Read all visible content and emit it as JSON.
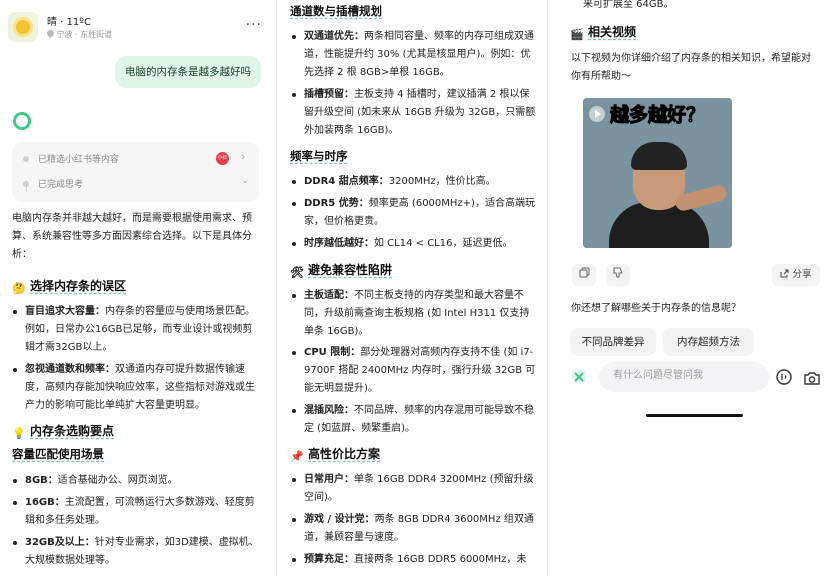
{
  "left": {
    "weather": "晴 · 11ºC",
    "location": "宁波 · 东胜街道",
    "more": "···",
    "user_message": "电脑的内存条是越多越好吗",
    "status_rows": [
      "已精选小红书等内容",
      "已完成思考"
    ],
    "intro": "电脑内存条并非越大越好，而是需要根据使用需求、预算、系统兼容性等多方面因素综合选择。以下是具体分析：",
    "section1": "选择内存条的误区",
    "bullets1": [
      {
        "bold": "盲目追求大容量：",
        "text": "内存条的容量应与使用场景匹配。例如，日常办公16GB已足够，而专业设计或视频剪辑才需32GB以上。"
      },
      {
        "bold": "忽视通道数和频率：",
        "text": "双通道内存可提升数据传输速度，高频内存能加快响应效率，这些指标对游戏或生产力的影响可能比单纯扩大容量更明显。"
      }
    ],
    "section2": "内存条选购要点",
    "sub1": "容量匹配使用场景",
    "bullets2": [
      {
        "bold": "8GB：",
        "text": "适合基础办公、网页浏览。"
      },
      {
        "bold": "16GB：",
        "text": "主流配置，可流畅运行大多数游戏、轻度剪辑和多任务处理。"
      },
      {
        "bold": "32GB及以上：",
        "text": "针对专业需求，如3D建模、虚拟机、大规模数据处理等。"
      }
    ]
  },
  "middle": {
    "heading1": "通道数与插槽规划",
    "bullets1": [
      {
        "bold": "双通道优先：",
        "text": "两条相同容量、频率的内存可组成双通道，性能提升约 30% (尤其是核显用户)。例如：优先选择 2 根 8GB>单根 16GB。"
      },
      {
        "bold": "插槽预留：",
        "text": "主板支持 4 插槽时，建议插满 2 根以保留升级空间 (如未来从 16GB 升级为 32GB，只需额外加装两条 16GB)。"
      }
    ],
    "heading2": "频率与时序",
    "bullets2": [
      {
        "bold": "DDR4 甜点频率：",
        "text": "3200MHz，性价比高。"
      },
      {
        "bold": "DDR5 优势：",
        "text": "频率更高 (6000MHz+)，适合高端玩家，但价格更贵。"
      },
      {
        "bold": "时序越低越好：",
        "text": "如 CL14 < CL16，延迟更低。"
      }
    ],
    "heading3": "避免兼容性陷阱",
    "bullets3": [
      {
        "bold": "主板适配：",
        "text": "不同主板支持的内存类型和最大容量不同，升级前需查询主板规格 (如 Intel H311 仅支持单条 16GB)。"
      },
      {
        "bold": "CPU 限制：",
        "text": "部分处理器对高频内存支持不佳 (如 i7-9700F 搭配 2400MHz 内存时，强行升级 32GB 可能无明显提升)。"
      },
      {
        "bold": "混插风险：",
        "text": "不同品牌、频率的内存混用可能导致不稳定 (如蓝屏、频繁重启)。"
      }
    ],
    "heading4": "高性价比方案",
    "bullets4": [
      {
        "bold": "日常用户：",
        "text": "单条 16GB DDR4 3200MHz (预留升级空间)。"
      },
      {
        "bold": "游戏 / 设计党：",
        "text": "两条 8GB DDR4 3600MHz 组双通道，兼顾容量与速度。"
      },
      {
        "bold": "预算充足：",
        "text": "直接两条 16GB DDR5 6000MHz，未"
      }
    ]
  },
  "right": {
    "cut_text": "来可扩展至 64GB。",
    "section": "相关视频",
    "video_intro": "以下视频为你详细介绍了内存条的相关知识，希望能对你有所帮助～",
    "video_title": "越多越好？",
    "share": "分享",
    "followup_q": "你还想了解哪些关于内存条的信息呢？",
    "chips": [
      "不同品牌差异",
      "内存超频方法"
    ],
    "input_placeholder": "有什么问题尽管问我"
  }
}
